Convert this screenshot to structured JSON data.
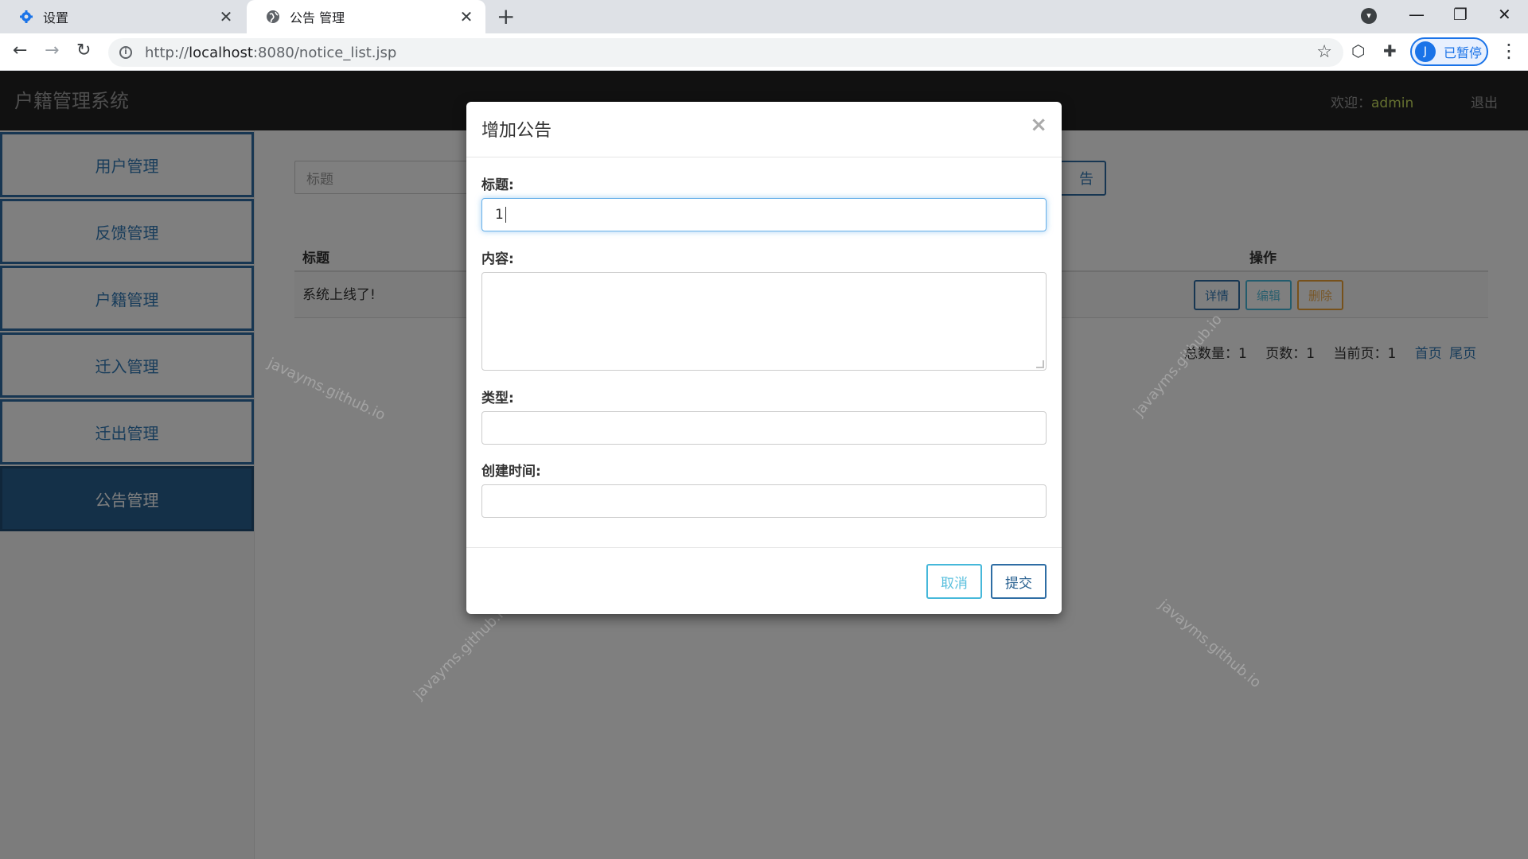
{
  "browser": {
    "tabs": [
      {
        "title": "设置",
        "icon": "gear-icon",
        "active": false
      },
      {
        "title": "公告 管理",
        "icon": "globe-icon",
        "active": true
      }
    ],
    "url_scheme": "http://",
    "url_host": "localhost",
    "url_rest": ":8080/notice_list.jsp",
    "profile_initial": "J",
    "profile_label": "已暂停"
  },
  "app": {
    "brand": "户籍管理系统",
    "welcome_label": "欢迎：",
    "username": "admin",
    "logout": "退出"
  },
  "sidebar": {
    "items": [
      {
        "label": "用户管理"
      },
      {
        "label": "反馈管理"
      },
      {
        "label": "户籍管理"
      },
      {
        "label": "迁入管理"
      },
      {
        "label": "迁出管理"
      },
      {
        "label": "公告管理"
      }
    ]
  },
  "main": {
    "search_placeholder": "标题",
    "add_button_fragment": "告",
    "table": {
      "headers": {
        "title": "标题",
        "operations": "操作"
      },
      "rows": [
        {
          "title": "系统上线了!"
        }
      ],
      "row_buttons": {
        "detail": "详情",
        "edit": "编辑",
        "delete": "删除"
      }
    },
    "pager": {
      "total": "总数量：1",
      "pages": "页数：1",
      "current": "当前页：1",
      "first": "首页",
      "last": "尾页"
    }
  },
  "watermark": "javayms.github.io",
  "modal": {
    "title": "增加公告",
    "close": "×",
    "fields": {
      "title_label": "标题:",
      "title_value": "1",
      "content_label": "内容:",
      "type_label": "类型:",
      "created_label": "创建时间:"
    },
    "cancel": "取消",
    "submit": "提交"
  },
  "colors": {
    "primary": "#337ab7",
    "info": "#5bc0de",
    "warning": "#f0ad4e",
    "navbar": "#222222",
    "sidebar_active": "#286090"
  }
}
